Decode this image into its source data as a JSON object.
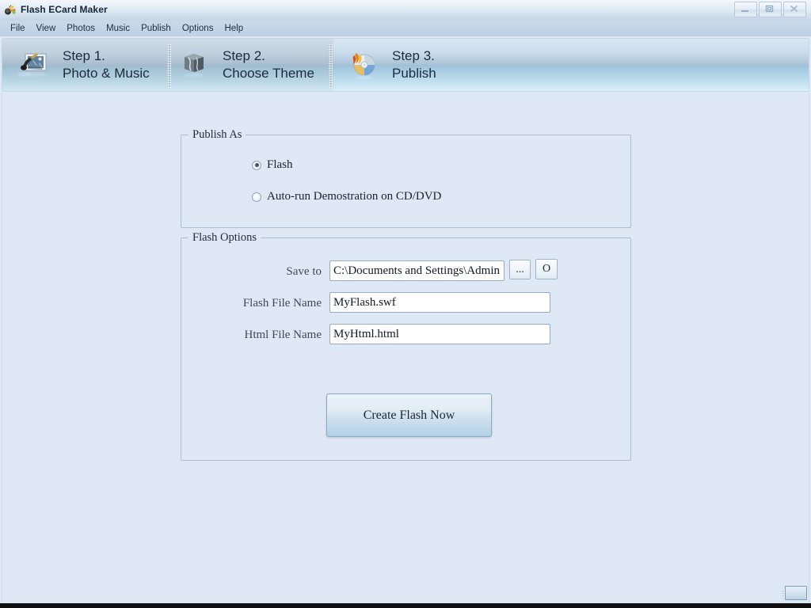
{
  "window": {
    "title": "Flash ECard Maker",
    "app_icon": "butterfly-icon",
    "buttons": [
      {
        "name": "minimize",
        "icon": "minimize-icon"
      },
      {
        "name": "maximize",
        "icon": "maximize-icon"
      },
      {
        "name": "close",
        "icon": "close-icon"
      }
    ]
  },
  "menubar": {
    "items": [
      {
        "label": "File"
      },
      {
        "label": "View"
      },
      {
        "label": "Photos"
      },
      {
        "label": "Music"
      },
      {
        "label": "Publish"
      },
      {
        "label": "Options"
      },
      {
        "label": "Help"
      }
    ]
  },
  "steps": [
    {
      "number": "Step 1.",
      "title": "Photo & Music",
      "icon": "photo-music-icon",
      "active": false
    },
    {
      "number": "Step 2.",
      "title": "Choose Theme",
      "icon": "theme-cube-icon",
      "active": false
    },
    {
      "number": "Step 3.",
      "title": "Publish",
      "icon": "burn-disc-icon",
      "active": true
    }
  ],
  "publish_as": {
    "legend": "Publish As",
    "options": [
      {
        "label": "Flash",
        "selected": true
      },
      {
        "label": "Auto-run Demostration on CD/DVD",
        "selected": false
      }
    ]
  },
  "flash_options": {
    "legend": "Flash Options",
    "fields": [
      {
        "label": "Save to",
        "value": "C:\\Documents and Settings\\Admin"
      },
      {
        "label": "Flash File Name",
        "value": "MyFlash.swf"
      },
      {
        "label": "Html File Name",
        "value": "MyHtml.html"
      }
    ],
    "browse_button": "...",
    "open_button": "O"
  },
  "actions": {
    "create_button": "Create Flash Now"
  },
  "colors": {
    "background": "#dfe9f5",
    "stepbar_bottom": "#bfe2f2",
    "titlebar_top": "#f3f7fb",
    "text": "#16222f",
    "field_border": "#93abc2"
  }
}
